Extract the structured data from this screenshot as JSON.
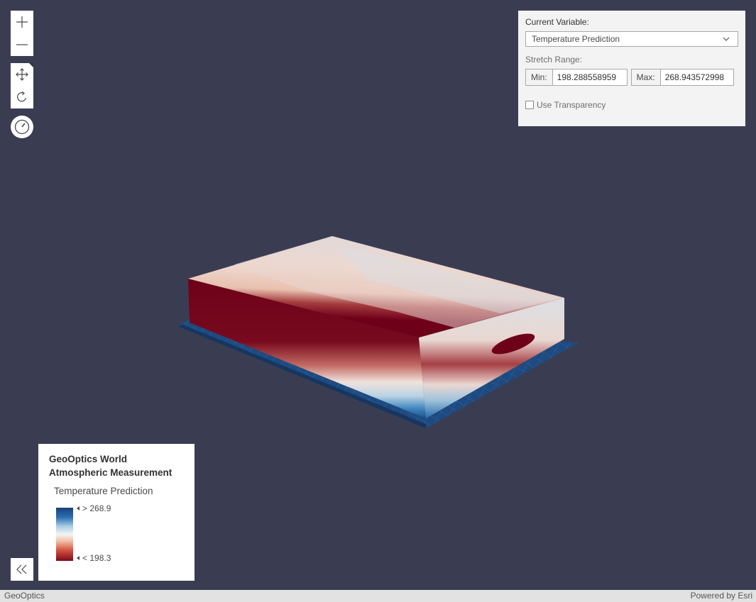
{
  "view_controls": {
    "zoom_in": "zoom-in-icon",
    "zoom_out": "zoom-out-icon",
    "pan": "pan-icon",
    "rotate": "rotate-icon",
    "compass": "compass-icon"
  },
  "variable_panel": {
    "current_variable_label": "Current Variable:",
    "selected_variable": "Temperature Prediction",
    "stretch_range_label": "Stretch Range:",
    "min_label": "Min:",
    "min_value": "198.288558959",
    "max_label": "Max:",
    "max_value": "268.943572998",
    "transparency_label": "Use Transparency",
    "transparency_checked": false
  },
  "legend": {
    "title_line1": "GeoOptics World",
    "title_line2": "Atmospheric Measurement",
    "variable": "Temperature Prediction",
    "high_label": "> 268.9",
    "low_label": "< 198.3",
    "ramp_colors": [
      "#1a3f7a",
      "#a8cde3",
      "#f4f4f2",
      "#d5523f",
      "#7b0a1a"
    ]
  },
  "collapse_button": "double-chevron-left-icon",
  "footer": {
    "left_text": "GeoOptics",
    "right_text": "Powered by Esri"
  },
  "colors": {
    "background": "#3a3d52",
    "panel": "#f3f3f3"
  }
}
